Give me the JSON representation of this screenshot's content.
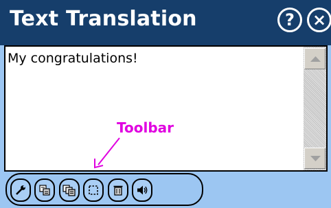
{
  "window": {
    "title": "Text Translation",
    "help_glyph": "?",
    "close_glyph": "×"
  },
  "editor": {
    "text": "My congratulations!"
  },
  "annotation": {
    "label": "Toolbar"
  },
  "toolbar": {
    "buttons": [
      {
        "icon": "wrench-icon"
      },
      {
        "icon": "translate-icon"
      },
      {
        "icon": "translate-all-icon"
      },
      {
        "icon": "select-icon"
      },
      {
        "icon": "trash-icon"
      },
      {
        "icon": "speaker-icon"
      }
    ]
  },
  "colors": {
    "titlebar": "#163e6b",
    "background": "#9cc6f2",
    "annotation": "#e000e0"
  }
}
